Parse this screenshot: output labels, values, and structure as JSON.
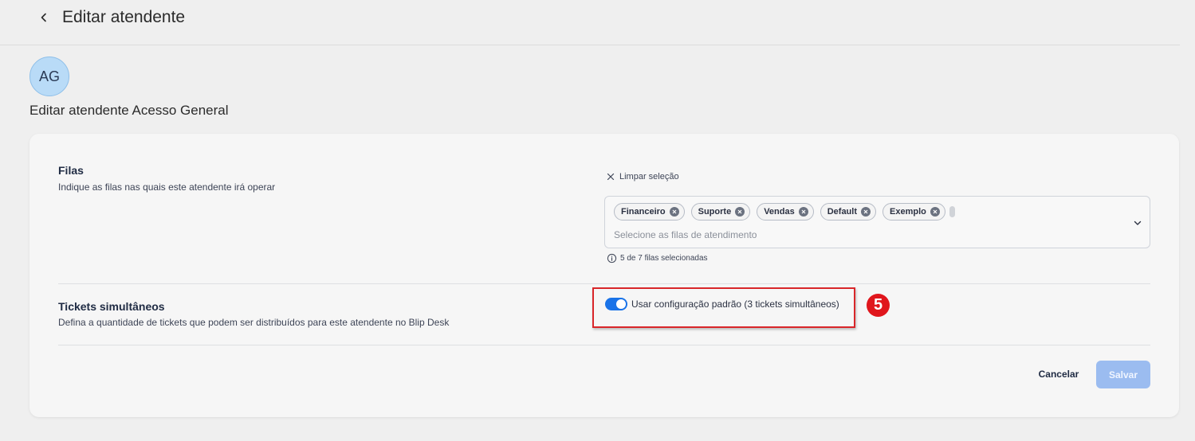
{
  "header": {
    "title": "Editar atendente"
  },
  "profile": {
    "initials": "AG",
    "subtitle": "Editar atendente Acesso General"
  },
  "filas": {
    "title": "Filas",
    "description": "Indique as filas nas quais este atendente irá operar",
    "clear_label": "Limpar seleção",
    "chips": [
      "Financeiro",
      "Suporte",
      "Vendas",
      "Default",
      "Exemplo"
    ],
    "placeholder": "Selecione as filas de atendimento",
    "helper": "5 de 7 filas selecionadas"
  },
  "tickets": {
    "title": "Tickets simultâneos",
    "description": "Defina a quantidade de tickets que podem ser distribuídos para este atendente no Blip Desk",
    "toggle_label": "Usar configuração padrão (3 tickets simultâneos)",
    "toggle_on": true
  },
  "annotation": {
    "step_number": "5",
    "color": "#e0161c"
  },
  "actions": {
    "cancel_label": "Cancelar",
    "save_label": "Salvar"
  },
  "colors": {
    "primary": "#1a73e8",
    "save_disabled": "#9bbcf0",
    "avatar_bg": "#b9dbf7"
  }
}
